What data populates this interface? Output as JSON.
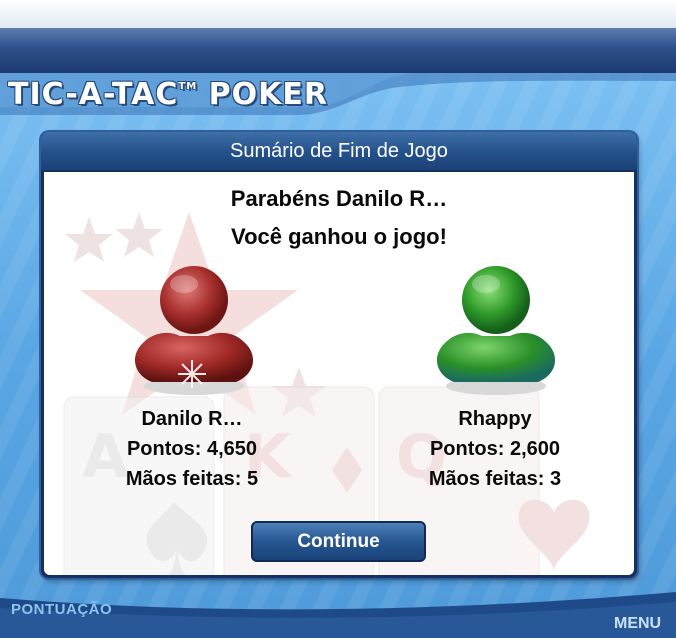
{
  "logo": {
    "text": "TIC-A-TAC",
    "tm": "TM",
    "text2": "POKER"
  },
  "dialog": {
    "title": "Sumário de Fim de Jogo",
    "congrats_line": "Parabéns Danilo R…",
    "result_line": "Você ganhou o jogo!",
    "continue_label": "Continue"
  },
  "players": [
    {
      "name": "Danilo R…",
      "points": "Pontos: 4,650",
      "hands": "Mãos feitas: 5",
      "color": "#a8302e"
    },
    {
      "name": "Rhappy",
      "points": "Pontos: 2,600",
      "hands": "Mãos feitas: 3",
      "color": "#2f9a2a"
    }
  ],
  "footer": {
    "score_label": "PONTUAÇÃO",
    "menu_label": "MENU"
  },
  "colors": {
    "dialog_header": "#24508a",
    "background": "#5aa8e6"
  }
}
